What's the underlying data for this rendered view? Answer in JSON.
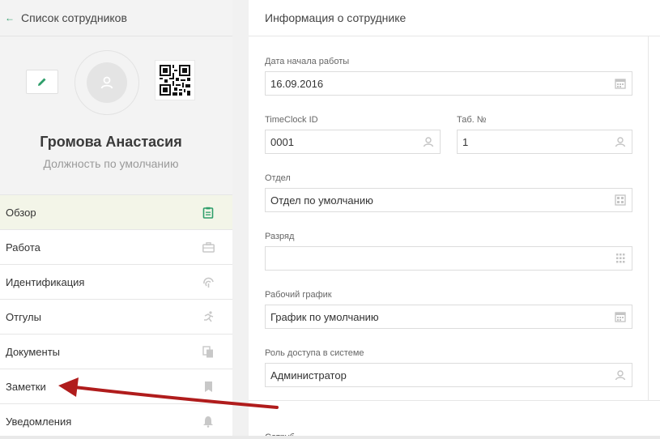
{
  "back": {
    "label": "Список сотрудников",
    "icon": "arrow-left-icon"
  },
  "profile": {
    "name": "Громова Анастасия",
    "position": "Должность по умолчанию"
  },
  "nav": [
    {
      "label": "Обзор",
      "icon": "clipboard-icon",
      "active": true
    },
    {
      "label": "Работа",
      "icon": "briefcase-icon"
    },
    {
      "label": "Идентификация",
      "icon": "fingerprint-icon"
    },
    {
      "label": "Отгулы",
      "icon": "running-person-icon"
    },
    {
      "label": "Документы",
      "icon": "documents-icon"
    },
    {
      "label": "Заметки",
      "icon": "bookmark-icon"
    },
    {
      "label": "Уведомления",
      "icon": "bell-icon"
    }
  ],
  "panel": {
    "title": "Информация о сотруднике"
  },
  "form": {
    "start_date": {
      "label": "Дата начала работы",
      "value": "16.09.2016"
    },
    "timeclock_id": {
      "label": "TimeClock ID",
      "value": "0001"
    },
    "tab_no": {
      "label": "Таб. №",
      "value": "1"
    },
    "department": {
      "label": "Отдел",
      "value": "Отдел по умолчанию"
    },
    "grade": {
      "label": "Разряд",
      "value": ""
    },
    "schedule": {
      "label": "Рабочий график",
      "value": "График по умолчанию"
    },
    "role": {
      "label": "Роль доступа в системе",
      "value": "Администратор"
    }
  },
  "cut_label": "Сотруб",
  "colors": {
    "accent": "#2e9e6a",
    "arrow": "#b01c1c",
    "active_bg": "#f3f5e8"
  }
}
